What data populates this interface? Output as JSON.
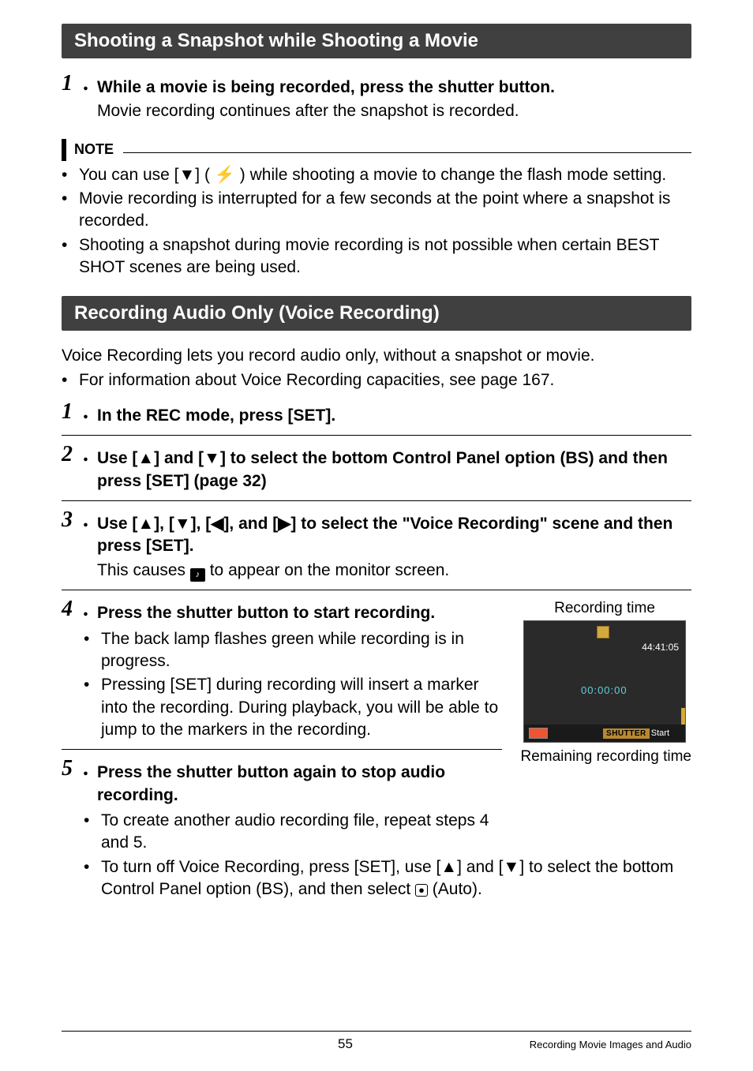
{
  "section1": {
    "title": "Shooting a Snapshot while Shooting a Movie",
    "step1_bold": "While a movie is being recorded, press the shutter button.",
    "step1_normal": "Movie recording continues after the snapshot is recorded."
  },
  "note": {
    "label": "NOTE",
    "items": [
      {
        "pre": "You can use [",
        "tri": "▼",
        "mid": "] ( ",
        "icon_text": "",
        "post": " ) while shooting a movie to change the flash mode setting.",
        "has_flash": true
      },
      {
        "text": "Movie recording is interrupted for a few seconds at the point where a snapshot is recorded."
      },
      {
        "text": "Shooting a snapshot during movie recording is not possible when certain BEST SHOT scenes are being used."
      }
    ]
  },
  "section2": {
    "title": "Recording Audio Only (Voice Recording)",
    "intro1": "Voice Recording lets you record audio only, without a snapshot or movie.",
    "intro2": "For information about Voice Recording capacities, see page 167."
  },
  "steps2": {
    "s1": "In the REC mode, press [SET].",
    "s2_pre": "Use [",
    "s2_t1": "▲",
    "s2_m1": "] and [",
    "s2_t2": "▼",
    "s2_post": "] to select the bottom Control Panel option (BS) and then press [SET] (page 32)",
    "s3_pre": "Use [",
    "s3_t1": "▲",
    "s3_m1": "], [",
    "s3_t2": "▼",
    "s3_m2": "], [",
    "s3_t3": "◀",
    "s3_m3": "], and [",
    "s3_t4": "▶",
    "s3_post": "] to select the \"Voice Recording\" scene and then press [SET].",
    "s3_sub_pre": "This causes ",
    "s3_sub_post": " to appear on the monitor screen.",
    "s4": "Press the shutter button to start recording.",
    "s4_b1": "The back lamp flashes green while recording is in progress.",
    "s4_b2": "Pressing [SET] during recording will insert a marker into the recording. During playback, you will be able to jump to the markers in the recording.",
    "s5": "Press the shutter button again to stop audio recording.",
    "s5_b1": "To create another audio recording file, repeat steps 4 and 5.",
    "s5_b2_pre": "To turn off Voice Recording, press [SET], use [",
    "s5_b2_t1": "▲",
    "s5_b2_m1": "] and [",
    "s5_b2_t2": "▼",
    "s5_b2_m2": "] to select the bottom Control Panel option (BS), and then select ",
    "s5_b2_post": " (Auto)."
  },
  "screenshot": {
    "top_label": "Recording time",
    "remain_time": "44:41:05",
    "elapsed": "00:00:00",
    "shutter": "SHUTTER",
    "start": "Start",
    "bottom_label": "Remaining recording time"
  },
  "footer": {
    "page": "55",
    "text": "Recording Movie Images and Audio"
  },
  "icons": {
    "mic": "♪",
    "cam": "●",
    "flash": "⚡"
  }
}
